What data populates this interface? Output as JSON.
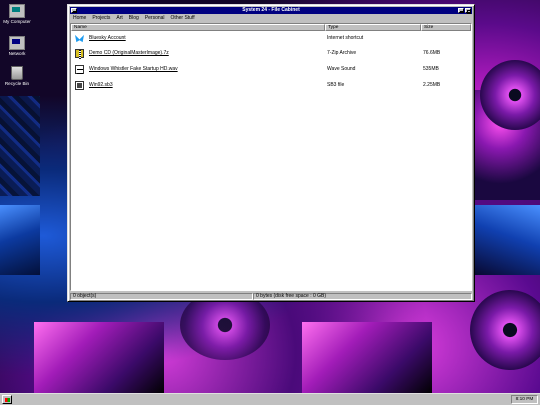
{
  "desktop": {
    "icons": [
      {
        "label": "My Computer",
        "icon": "computer-icon"
      },
      {
        "label": "Network",
        "icon": "network-icon"
      },
      {
        "label": "Recycle Bin",
        "icon": "recycle-bin-icon"
      }
    ]
  },
  "window": {
    "title": "System 24 - File Cabinet",
    "menu": [
      "Home",
      "Projects",
      "Art",
      "Blog",
      "Personal",
      "Other Stuff"
    ],
    "columns": {
      "name": "Name",
      "type": "Type",
      "size": "Size"
    },
    "files": [
      {
        "name": "Bluesky Account",
        "type": "Internet shortcut",
        "size": "",
        "icon": "butterfly-icon"
      },
      {
        "name": "Demo CD (OriginalMasterImage).7z",
        "type": "7-Zip Archive",
        "size": "76.6MB",
        "icon": "zip-icon"
      },
      {
        "name": "Windows Whistler Fake Startup HD.wav",
        "type": "Wave Sound",
        "size": "535MB",
        "icon": "wave-sound-icon"
      },
      {
        "name": "Win92.sb3",
        "type": "SB3 file",
        "size": "2.25MB",
        "icon": "sb3-file-icon"
      }
    ],
    "status": {
      "left": "0 object(s)",
      "right": "0 bytes (disk free space : 0 GB)"
    }
  },
  "taskbar": {
    "clock": "8:10 PM"
  }
}
